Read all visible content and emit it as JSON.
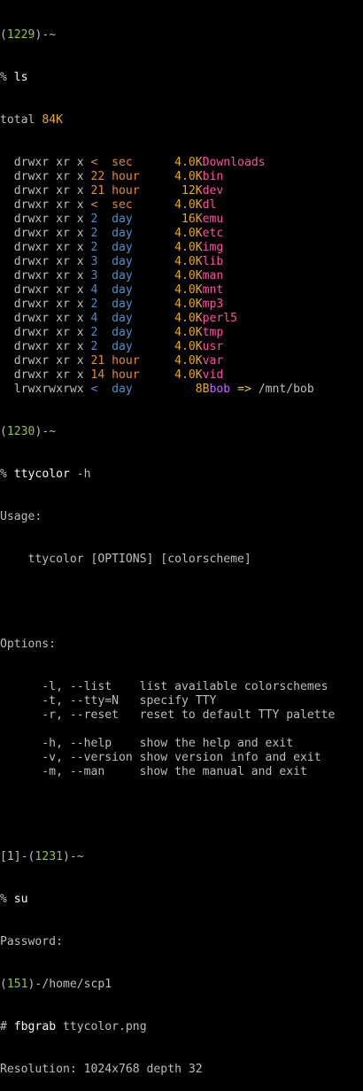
{
  "colors": {
    "prompt_green": "#8ec63f",
    "dir_name": "#ff4fa0",
    "size": "#e6a81e",
    "time_blue": "#4c8fd0",
    "time_orange": "#e8892b",
    "symlink": "#c06bff"
  },
  "prompt1": {
    "open": "(",
    "num": "1229",
    "close": ")-~"
  },
  "cmd1": {
    "prompt": "% ",
    "command": "ls"
  },
  "total": {
    "label": "total ",
    "value": "84K"
  },
  "listing": [
    {
      "perm": "  drwxr xr x ",
      "num": "<",
      "unit": "  sec ",
      "size": "     4.0K",
      "name": "Downloads",
      "age": "orange",
      "kind": "dir"
    },
    {
      "perm": "  drwxr xr x ",
      "num": "22",
      "unit": " hour ",
      "size": "    4.0K",
      "name": "bin",
      "age": "orange",
      "kind": "dir"
    },
    {
      "perm": "  drwxr xr x ",
      "num": "21",
      "unit": " hour ",
      "size": "     12K",
      "name": "dev",
      "age": "orange",
      "kind": "dir"
    },
    {
      "perm": "  drwxr xr x ",
      "num": "<",
      "unit": "  sec ",
      "size": "     4.0K",
      "name": "dl",
      "age": "orange",
      "kind": "dir"
    },
    {
      "perm": "  drwxr xr x ",
      "num": "2",
      "unit": "  day ",
      "size": "      16K",
      "name": "emu",
      "age": "blue",
      "kind": "dir"
    },
    {
      "perm": "  drwxr xr x ",
      "num": "2",
      "unit": "  day ",
      "size": "     4.0K",
      "name": "etc",
      "age": "blue",
      "kind": "dir"
    },
    {
      "perm": "  drwxr xr x ",
      "num": "2",
      "unit": "  day ",
      "size": "     4.0K",
      "name": "img",
      "age": "blue",
      "kind": "dir"
    },
    {
      "perm": "  drwxr xr x ",
      "num": "3",
      "unit": "  day ",
      "size": "     4.0K",
      "name": "lib",
      "age": "blue",
      "kind": "dir"
    },
    {
      "perm": "  drwxr xr x ",
      "num": "3",
      "unit": "  day ",
      "size": "     4.0K",
      "name": "man",
      "age": "blue",
      "kind": "dir"
    },
    {
      "perm": "  drwxr xr x ",
      "num": "4",
      "unit": "  day ",
      "size": "     4.0K",
      "name": "mnt",
      "age": "blue",
      "kind": "dir"
    },
    {
      "perm": "  drwxr xr x ",
      "num": "2",
      "unit": "  day ",
      "size": "     4.0K",
      "name": "mp3",
      "age": "blue",
      "kind": "dir"
    },
    {
      "perm": "  drwxr xr x ",
      "num": "4",
      "unit": "  day ",
      "size": "     4.0K",
      "name": "perl5",
      "age": "blue",
      "kind": "dir"
    },
    {
      "perm": "  drwxr xr x ",
      "num": "2",
      "unit": "  day ",
      "size": "     4.0K",
      "name": "tmp",
      "age": "blue",
      "kind": "dir"
    },
    {
      "perm": "  drwxr xr x ",
      "num": "2",
      "unit": "  day ",
      "size": "     4.0K",
      "name": "usr",
      "age": "blue",
      "kind": "dir"
    },
    {
      "perm": "  drwxr xr x ",
      "num": "21",
      "unit": " hour ",
      "size": "    4.0K",
      "name": "var",
      "age": "orange",
      "kind": "dir"
    },
    {
      "perm": "  drwxr xr x ",
      "num": "14",
      "unit": " hour ",
      "size": "    4.0K",
      "name": "vid",
      "age": "orange",
      "kind": "dir"
    },
    {
      "perm": "  lrwxrwxrwx ",
      "num": "<",
      "unit": "  day ",
      "size": "        8B",
      "name": "bob",
      "arrow": " => ",
      "target": "/mnt/bob",
      "age": "blue",
      "kind": "link"
    }
  ],
  "prompt2": {
    "open": "(",
    "num": "1230",
    "close": ")-~"
  },
  "cmd2": {
    "prompt": "% ",
    "command": "ttycolor",
    "args": " -h"
  },
  "help": {
    "usage_label": "Usage:",
    "usage_line": "    ttycolor [OPTIONS] [colorscheme]",
    "options_label": "Options:",
    "options": [
      "      -l, --list    list available colorschemes",
      "      -t, --tty=N   specify TTY",
      "      -r, --reset   reset to default TTY palette",
      "",
      "      -h, --help    show the help and exit",
      "      -v, --version show version info and exit",
      "      -m, --man     show the manual and exit"
    ]
  },
  "prompt3": {
    "pre": "[1]-(",
    "num": "1231",
    "close": ")-~"
  },
  "cmd3": {
    "prompt": "% ",
    "command": "su"
  },
  "password_label": "Password:",
  "prompt4": {
    "open": "(",
    "num": "151",
    "close": ")-/home/scp1"
  },
  "cmd4": {
    "prompt": "# ",
    "command": "fbgrab",
    "args": " ttycolor.png"
  },
  "resolution": "Resolution: 1024x768 depth 32"
}
